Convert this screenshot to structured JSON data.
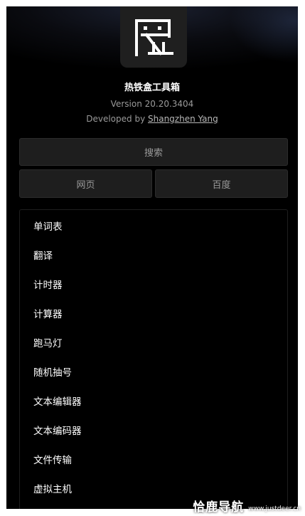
{
  "app": {
    "name": "热铁盒工具箱",
    "version": "Version 20.20.3404",
    "developed_by_prefix": "Developed by",
    "developer": "Shangzhen Yang"
  },
  "search": {
    "search_label": "搜索",
    "web_label": "网页",
    "baidu_label": "百度"
  },
  "tools": [
    {
      "label": "单词表"
    },
    {
      "label": "翻译"
    },
    {
      "label": "计时器"
    },
    {
      "label": "计算器"
    },
    {
      "label": "跑马灯"
    },
    {
      "label": "随机抽号"
    },
    {
      "label": "文本编辑器"
    },
    {
      "label": "文本编码器"
    },
    {
      "label": "文件传输"
    },
    {
      "label": "虚拟主机"
    }
  ],
  "watermark": {
    "name": "恰鹿导航",
    "url": "www.justdeer.cn"
  },
  "colors": {
    "background": "#000000",
    "button_bg": "#1e1e1e",
    "text_primary": "#ffffff",
    "text_muted": "#9a9a9a"
  }
}
